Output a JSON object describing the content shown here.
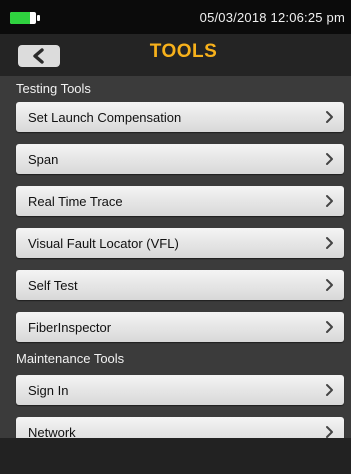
{
  "status_bar": {
    "datetime": "05/03/2018 12:06:25 pm",
    "battery_level": 0.78,
    "battery_color": "#2fd23f"
  },
  "header": {
    "back_icon": "chevron-left-icon",
    "title": "TOOLS",
    "title_color": "#f7b11b"
  },
  "sections": {
    "testing": {
      "label": "Testing Tools",
      "items": [
        {
          "label": "Set Launch Compensation"
        },
        {
          "label": "Span"
        },
        {
          "label": "Real Time Trace"
        },
        {
          "label": "Visual Fault Locator (VFL)"
        },
        {
          "label": "Self Test"
        },
        {
          "label": "FiberInspector"
        }
      ]
    },
    "maintenance": {
      "label": "Maintenance Tools",
      "items": [
        {
          "label": "Sign In"
        },
        {
          "label": "Network"
        }
      ]
    }
  },
  "item_icon": "chevron-right-icon"
}
